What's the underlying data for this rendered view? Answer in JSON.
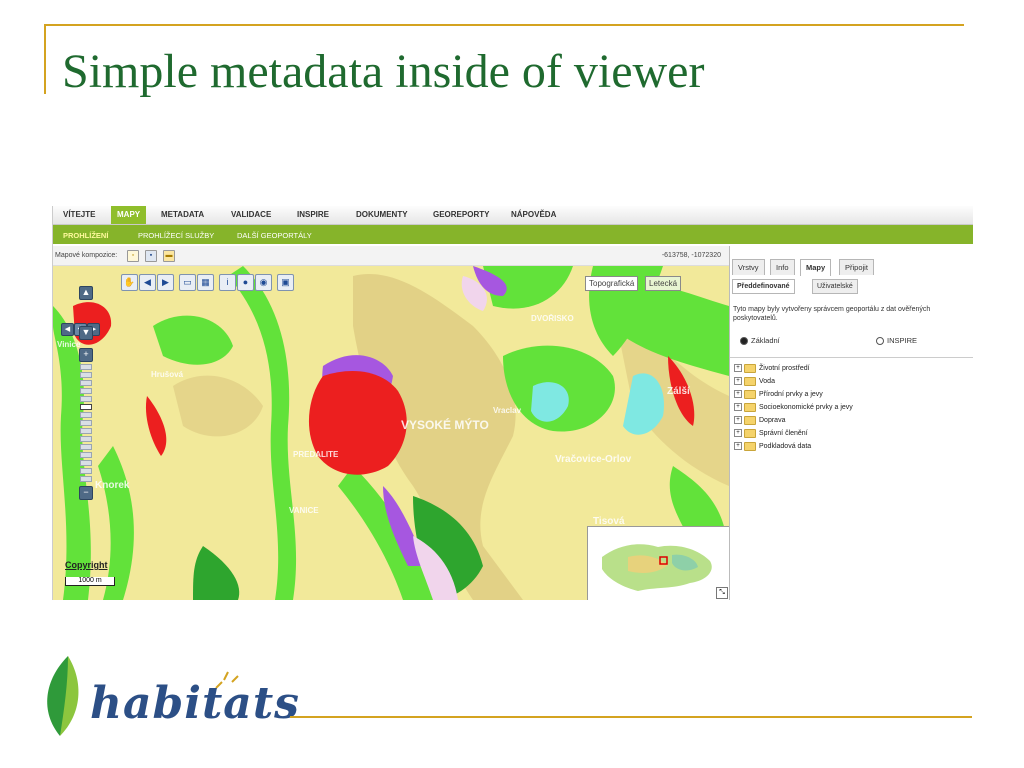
{
  "slide": {
    "title": "Simple metadata inside of viewer",
    "logo_text": "habitats"
  },
  "colors": {
    "accent_rule": "#d4a320",
    "title": "#1f6a2f",
    "nav_green": "#86b42a"
  },
  "nav": {
    "main": [
      "VÍTEJTE",
      "MAPY",
      "METADATA",
      "VALIDACE",
      "INSPIRE",
      "DOKUMENTY",
      "GEOREPORTY",
      "NÁPOVĚDA"
    ],
    "active_main": "MAPY",
    "sub": [
      "PROHLÍŽENÍ",
      "PROHLÍŽECÍ SLUŽBY",
      "DALŠÍ GEOPORTÁLY"
    ],
    "active_sub": "PROHLÍŽENÍ"
  },
  "map": {
    "compositions_label": "Mapové kompozice:",
    "coordinates": "-613758, -1072320",
    "layer_buttons": [
      "Topografická",
      "Letecká"
    ],
    "copyright": "Copyright",
    "scale": "1000 m",
    "place_labels": [
      "DVOŘISKO",
      "Vinice",
      "Hrušová",
      "VYSOKÉ MÝTO",
      "Vraclav",
      "Vračovice-Orlov",
      "Tisová",
      "Zálší",
      "VANICE",
      "PREDALITE",
      "Knorek"
    ],
    "toolbar_icons": [
      "hand-pan-icon",
      "arrow-left-icon",
      "arrow-right-icon",
      "zoom-box-icon",
      "measure-icon",
      "info-icon",
      "pin-icon",
      "globe-icon",
      "print-icon"
    ]
  },
  "panel": {
    "tabs": [
      "Vrstvy",
      "Info",
      "Mapy",
      "Připojit"
    ],
    "active_tab": "Mapy",
    "subtabs": [
      "Předdefinované",
      "Uživatelské"
    ],
    "active_subtab": "Předdefinované",
    "description": "Tyto mapy byly vytvořeny správcem geoportálu z dat ověřených poskytovatelů.",
    "radios": [
      {
        "label": "Základní",
        "checked": true
      },
      {
        "label": "INSPIRE",
        "checked": false
      }
    ],
    "tree": [
      "Životní prostředí",
      "Voda",
      "Přírodní prvky a jevy",
      "Socioekonomické prvky a jevy",
      "Doprava",
      "Správní členění",
      "Podkladová data"
    ]
  }
}
